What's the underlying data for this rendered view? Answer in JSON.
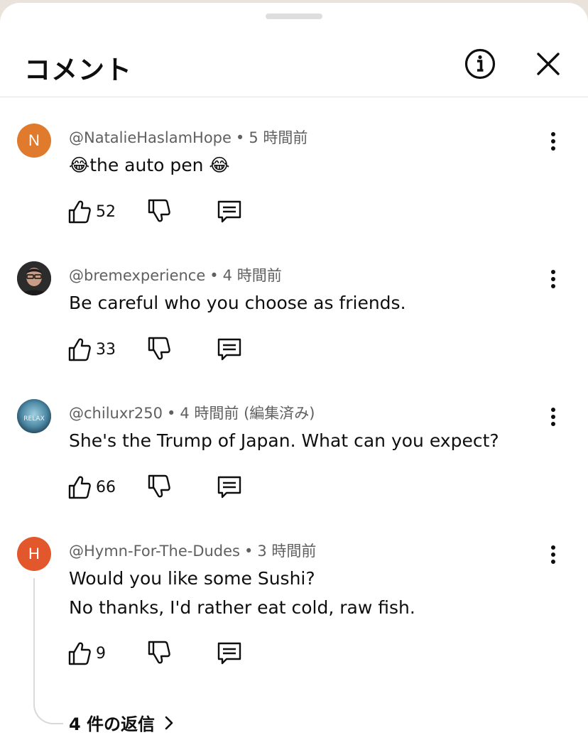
{
  "header": {
    "title": "コメント",
    "info_icon": "info-icon",
    "close_icon": "close-icon"
  },
  "comments": [
    {
      "author": "@NatalieHaslamHope",
      "time": "5 時間前",
      "edited": "",
      "text_lines": [
        "😂the auto pen 😂"
      ],
      "avatar_letter": "N",
      "avatar_color": "#e07a2c",
      "likes": "52"
    },
    {
      "author": "@bremexperience",
      "time": "4 時間前",
      "edited": "",
      "text_lines": [
        "Be careful who you choose as friends."
      ],
      "avatar_letter": "",
      "avatar_color": "#3a3a3a",
      "likes": "33"
    },
    {
      "author": "@chiluxr250",
      "time": "4 時間前",
      "edited": "(編集済み)",
      "text_lines": [
        "She's the Trump of Japan. What can you expect?"
      ],
      "avatar_letter": "RELAX",
      "avatar_color": "#4a7f9a",
      "likes": "66"
    },
    {
      "author": "@Hymn-For-The-Dudes",
      "time": "3 時間前",
      "edited": "",
      "text_lines": [
        "Would you like some Sushi?",
        "No thanks, I'd rather eat cold, raw fish."
      ],
      "avatar_letter": "H",
      "avatar_color": "#e2572c",
      "likes": "9"
    }
  ],
  "replies_link": {
    "label": "4 件の返信",
    "icon": "chevron-right-icon"
  },
  "colors": {
    "text": "#0f0f0f",
    "meta": "#606060",
    "divider": "#e2e2e2"
  }
}
